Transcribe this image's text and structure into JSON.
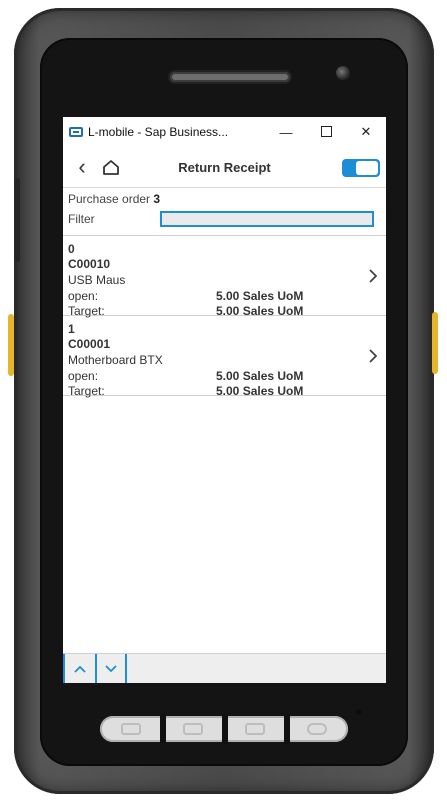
{
  "window": {
    "title": "L-mobile - Sap Business...",
    "minimize_glyph": "—",
    "close_glyph": "✕"
  },
  "nav": {
    "back_glyph": "‹",
    "title": "Return Receipt"
  },
  "header": {
    "purchase_order_label": "Purchase order",
    "purchase_order_value": "3",
    "filter_label": "Filter",
    "filter_value": ""
  },
  "items": [
    {
      "index": "0",
      "code": "C00010",
      "name": "USB Maus",
      "open_label": "open:",
      "open_value": "5.00 Sales UoM",
      "target_label": "Target:",
      "target_value": "5.00 Sales UoM"
    },
    {
      "index": "1",
      "code": "C00001",
      "name": "Motherboard BTX",
      "open_label": "open:",
      "open_value": "5.00 Sales UoM",
      "target_label": "Target:",
      "target_value": "5.00 Sales UoM"
    }
  ],
  "footer": {
    "up_glyph": "⌃",
    "down_glyph": "⌄"
  },
  "colors": {
    "accent": "#1d8ed6",
    "bar": "#eeeeee"
  }
}
